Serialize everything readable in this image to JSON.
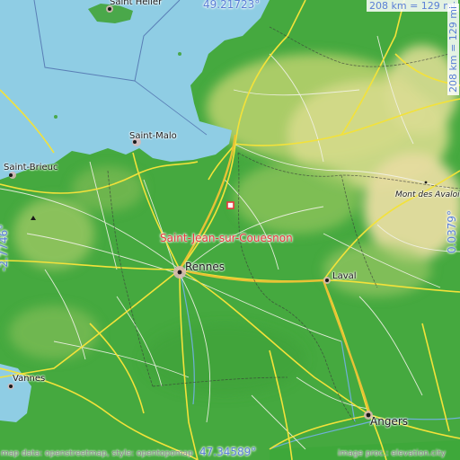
{
  "map": {
    "place_name": "Saint-Jean-sur-Couesnon",
    "lat_top": "49.21723°",
    "lat_bottom": "47.34589°",
    "lon_left": "-2.7746°",
    "lon_right": "0.0379°",
    "scale_horizontal": "208 km = 129 mi",
    "scale_vertical": "208 km = 129 mi",
    "credit_left": "map data: openstreetmap, style: opentopomap",
    "credit_right": "image proc.: elevation.city",
    "colors": {
      "sea": "#8fcde4",
      "lowland": "#3ea83a",
      "upland": "#c8d77a",
      "highland": "#e9dfa1",
      "marker": "#e8383d",
      "coord_text": "#5a7fd6"
    },
    "cities": [
      {
        "name": "Saint Helier"
      },
      {
        "name": "Saint-Malo"
      },
      {
        "name": "Saint-Brieuc"
      },
      {
        "name": "Rennes"
      },
      {
        "name": "Laval"
      },
      {
        "name": "Mont des Avaloirs"
      },
      {
        "name": "Vannes"
      },
      {
        "name": "Angers"
      }
    ]
  }
}
